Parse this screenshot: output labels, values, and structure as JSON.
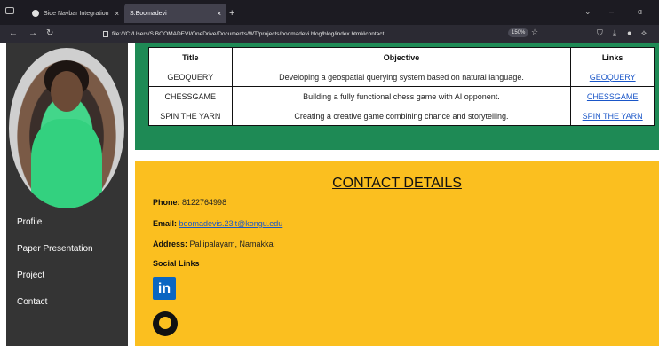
{
  "browser": {
    "tabs": [
      {
        "label": "Side Navbar Integration",
        "close": "×"
      },
      {
        "label": "S.Boomadevi",
        "close": "×"
      }
    ],
    "new_tab": "+",
    "url": "file:///C:/Users/S.BOOMADEVI/OneDrive/Documents/WT/projects/boomadevi blog/blog/index.html#contact",
    "zoom": "150%",
    "window_controls": {
      "menu": "⌄",
      "minimize": "–",
      "close": "ɑ"
    }
  },
  "sidebar": {
    "items": [
      "Profile",
      "Paper Presentation",
      "Project",
      "Contact"
    ]
  },
  "projects": {
    "headers": [
      "Title",
      "Objective",
      "Links"
    ],
    "rows": [
      {
        "title": "GEOQUERY",
        "objective": "Developing a geospatial querying system based on natural language.",
        "link": "GEOQUERY"
      },
      {
        "title": "CHESSGAME",
        "objective": "Building a fully functional chess game with AI opponent.",
        "link": "CHESSGAME"
      },
      {
        "title": "SPIN THE YARN",
        "objective": "Creating a creative game combining chance and storytelling.",
        "link": "SPIN THE YARN"
      }
    ]
  },
  "contact": {
    "title": "CONTACT DETAILS",
    "phone_label": "Phone:",
    "phone": "8122764998",
    "email_label": "Email:",
    "email": "boomadevis.23it@kongu.edu",
    "address_label": "Address:",
    "address": "Pallipalayam, Namakkal",
    "social_label": "Social Links",
    "linkedin_glyph": "in"
  },
  "colors": {
    "green": "#1e8a55",
    "yellow": "#fbbf1f",
    "sidebar": "#343434",
    "link": "#1a56c8"
  },
  "icons": [
    "tab-list-icon",
    "back-arrow-icon",
    "forward-arrow-icon",
    "reload-icon",
    "page-icon",
    "star-icon",
    "shield-icon",
    "download-icon",
    "account-icon",
    "extensions-icon",
    "linkedin-icon",
    "github-icon"
  ]
}
